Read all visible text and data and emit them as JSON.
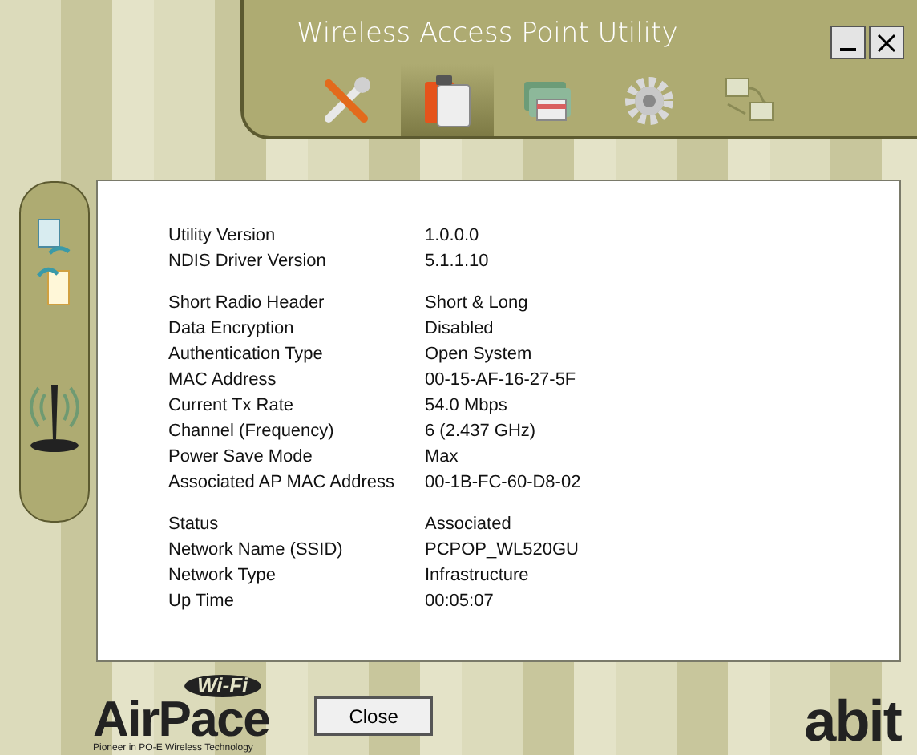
{
  "window": {
    "title": "Wireless Access Point Utility"
  },
  "tabs": [
    {
      "kind": "tools",
      "selected": false
    },
    {
      "kind": "clipboard",
      "selected": true
    },
    {
      "kind": "cards",
      "selected": false
    },
    {
      "kind": "gear",
      "selected": false
    },
    {
      "kind": "network",
      "selected": false
    }
  ],
  "sidebar": {
    "items": [
      {
        "kind": "export"
      },
      {
        "kind": "import"
      }
    ]
  },
  "info_groups": [
    {
      "rows": [
        {
          "label": "Utility Version",
          "value": "1.0.0.0"
        },
        {
          "label": "NDIS Driver Version",
          "value": "5.1.1.10"
        }
      ]
    },
    {
      "rows": [
        {
          "label": "Short Radio Header",
          "value": "Short & Long"
        },
        {
          "label": "Data Encryption",
          "value": "Disabled"
        },
        {
          "label": "Authentication Type",
          "value": "Open System"
        },
        {
          "label": "MAC Address",
          "value": "00-15-AF-16-27-5F"
        },
        {
          "label": "Current Tx Rate",
          "value": "54.0 Mbps"
        },
        {
          "label": "Channel (Frequency)",
          "value": "6 (2.437 GHz)"
        },
        {
          "label": "Power Save Mode",
          "value": "Max"
        },
        {
          "label": "Associated AP MAC Address",
          "value": "00-1B-FC-60-D8-02"
        }
      ]
    },
    {
      "rows": [
        {
          "label": "Status",
          "value": "Associated"
        },
        {
          "label": "Network Name (SSID)",
          "value": "PCPOP_WL520GU"
        },
        {
          "label": "Network Type",
          "value": "Infrastructure"
        },
        {
          "label": "Up Time",
          "value": "00:05:07"
        }
      ]
    }
  ],
  "buttons": [
    "Close"
  ],
  "logo_left": {
    "badge": "Wi-Fi",
    "name": "AirPace",
    "tagline": "Pioneer in PO-E Wireless Technology"
  },
  "logo_right": {
    "name": "abit"
  }
}
